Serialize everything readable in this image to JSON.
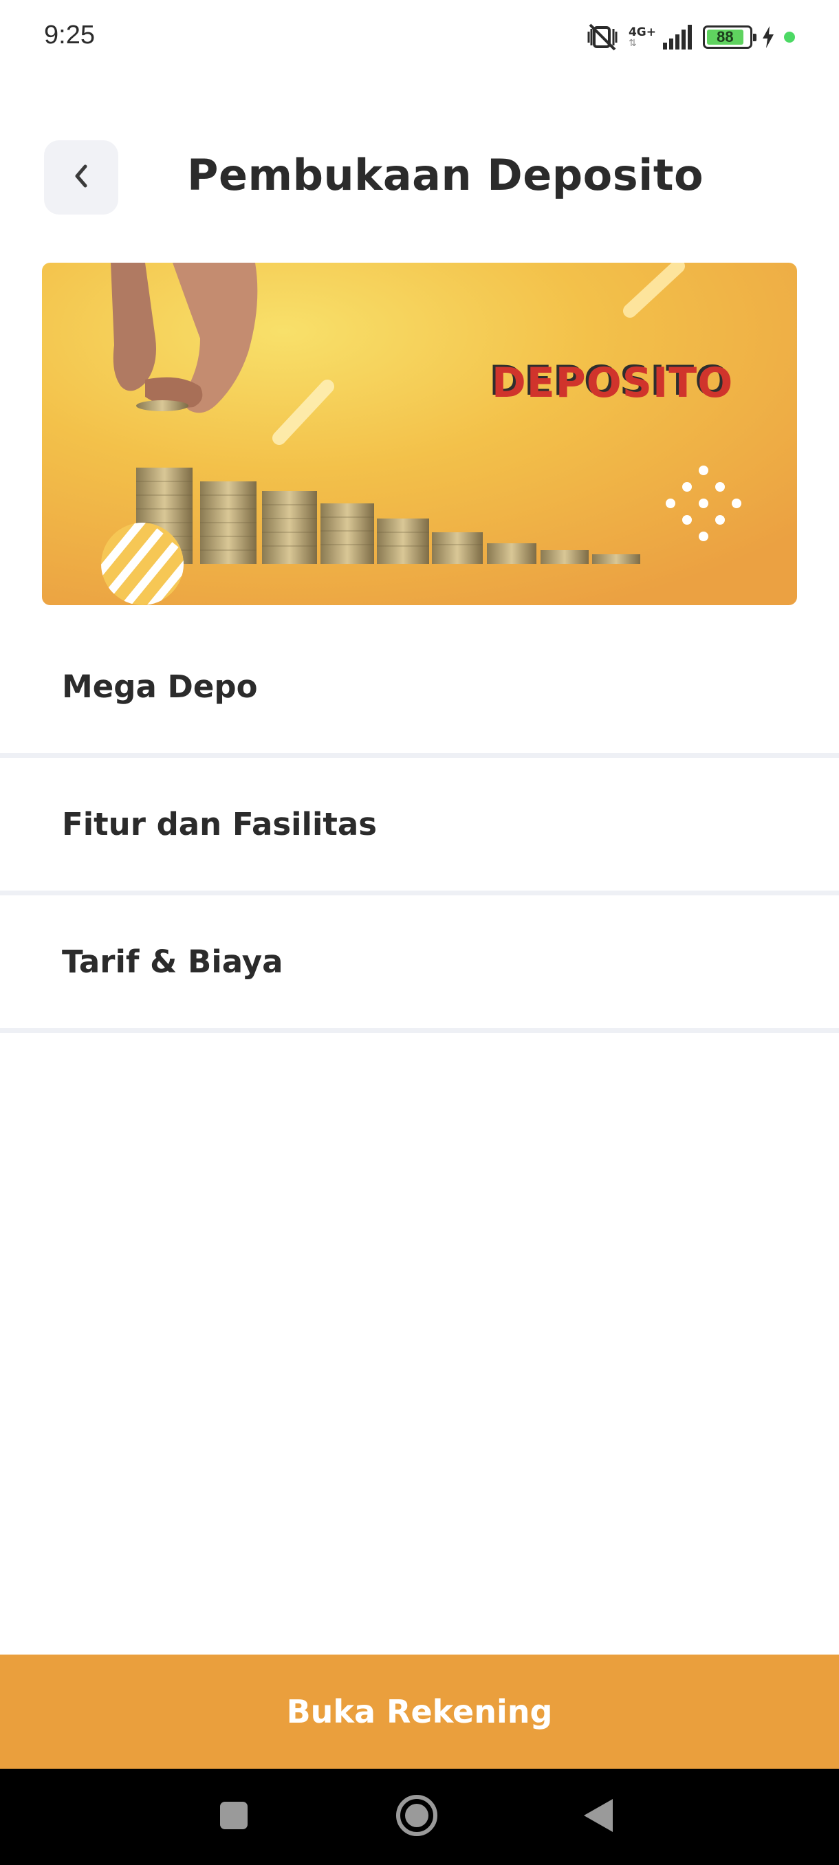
{
  "status_bar": {
    "time": "9:25",
    "network": "4G+",
    "battery_level": "88",
    "battery_fraction": 0.88,
    "icons": [
      "mute-vibrate-icon",
      "signal-icon",
      "battery-icon",
      "charging-icon",
      "green-dot-indicator"
    ]
  },
  "header": {
    "back_icon": "chevron-left-icon",
    "title": "Pembukaan Deposito"
  },
  "banner": {
    "text": "DEPOSITO"
  },
  "menu": {
    "items": [
      {
        "label": "Mega Depo"
      },
      {
        "label": "Fitur dan Fasilitas"
      },
      {
        "label": "Tarif & Biaya"
      }
    ]
  },
  "cta": {
    "label": "Buka Rekening"
  },
  "nav": {
    "buttons": [
      "recents-square-icon",
      "home-circle-icon",
      "back-triangle-icon"
    ]
  },
  "colors": {
    "accent": "#ea9f3d",
    "text": "#2b2b2b",
    "divider": "#eef0f5",
    "back_button_bg": "#f1f2f6",
    "banner_title": "#d0342c"
  }
}
